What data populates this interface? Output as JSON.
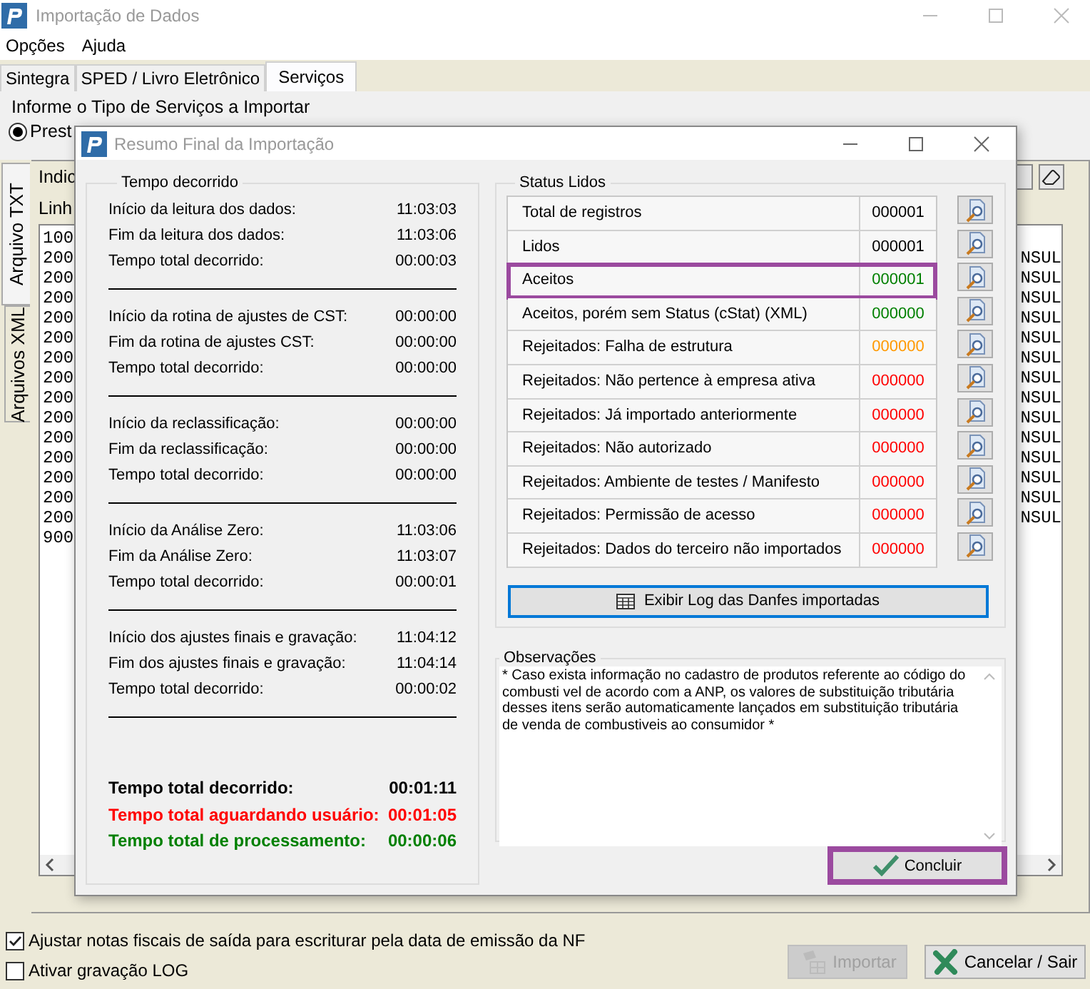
{
  "window": {
    "title": "Importação de Dados"
  },
  "menu": [
    "Opções",
    "Ajuda"
  ],
  "tabs": [
    {
      "label": "Sintegra",
      "selected": false
    },
    {
      "label": "SPED / Livro Eletrônico",
      "selected": false
    },
    {
      "label": "Serviços",
      "selected": true
    }
  ],
  "service_group": {
    "title": "Informe o Tipo de Serviços a Importar",
    "radio": {
      "label": "Prest",
      "selected": true
    }
  },
  "side_tabs": [
    {
      "label": "Arquivo TXT",
      "selected": true
    },
    {
      "label": "Arquivos XML",
      "selected": false
    }
  ],
  "labels": [
    "Indic",
    "Linh"
  ],
  "log_lines": [
    {
      "start": "100"
    },
    {
      "start": "200",
      "end": "NSUL"
    },
    {
      "start": "200",
      "end": "NSUL"
    },
    {
      "start": "200",
      "end": "NSUL"
    },
    {
      "start": "200",
      "end": "NSUL"
    },
    {
      "start": "200",
      "end": "NSUL"
    },
    {
      "start": "200",
      "end": "NSUL"
    },
    {
      "start": "200",
      "end": "NSUL"
    },
    {
      "start": "200",
      "end": "NSUL"
    },
    {
      "start": "200",
      "end": "NSUL"
    },
    {
      "start": "200",
      "end": "NSUL"
    },
    {
      "start": "200",
      "end": "NSUL"
    },
    {
      "start": "200",
      "end": "NSUL"
    },
    {
      "start": "200",
      "end": "NSUL"
    },
    {
      "start": "200",
      "end": "NSUL"
    },
    {
      "start": "900"
    }
  ],
  "options": [
    {
      "label": "Ajustar notas fiscais de saída para escriturar pela data de emissão da NF",
      "checked": true
    },
    {
      "label": "Ativar gravação LOG",
      "checked": false
    }
  ],
  "buttons": [
    {
      "kind": "import",
      "label": "Importar",
      "disabled": true
    },
    {
      "kind": "cancel",
      "label": "Cancelar / Sair",
      "disabled": false
    }
  ],
  "dialog": {
    "title": "Resumo Final da Importação",
    "time_group": {
      "title": "Tempo decorrido",
      "sections": [
        [
          {
            "label": "Início da leitura dos dados:",
            "value": "11:03:03"
          },
          {
            "label": "Fim da leitura dos dados:",
            "value": "11:03:06"
          },
          {
            "label": "Tempo total decorrido:",
            "value": "00:00:03"
          }
        ],
        [
          {
            "label": "Início da rotina de ajustes de CST:",
            "value": "00:00:00"
          },
          {
            "label": "Fim da rotina de ajustes CST:",
            "value": "00:00:00"
          },
          {
            "label": "Tempo total decorrido:",
            "value": "00:00:00"
          }
        ],
        [
          {
            "label": "Início da reclassificação:",
            "value": "00:00:00"
          },
          {
            "label": "Fim da reclassificação:",
            "value": "00:00:00"
          },
          {
            "label": "Tempo total decorrido:",
            "value": "00:00:00"
          }
        ],
        [
          {
            "label": "Início da Análise Zero:",
            "value": "11:03:06"
          },
          {
            "label": "Fim da Análise Zero:",
            "value": "11:03:07"
          },
          {
            "label": "Tempo total decorrido:",
            "value": "00:00:01"
          }
        ],
        [
          {
            "label": "Início dos ajustes finais e gravação:",
            "value": "11:04:12"
          },
          {
            "label": "Fim dos ajustes finais e gravação:",
            "value": "11:04:14"
          },
          {
            "label": "Tempo total decorrido:",
            "value": "00:00:02"
          }
        ]
      ],
      "totals": [
        {
          "label": "Tempo total decorrido:",
          "value": "00:01:11",
          "color": "#000000"
        },
        {
          "label": "Tempo total aguardando usuário:",
          "value": "00:01:05",
          "color": "#ff0000"
        },
        {
          "label": "Tempo total de processamento:",
          "value": "00:00:06",
          "color": "#008000"
        }
      ]
    },
    "status_group": {
      "title": "Status Lidos",
      "rows": [
        {
          "label": "Total de registros",
          "value": "000001",
          "color": "#000000",
          "highlighted": false
        },
        {
          "label": "Lidos",
          "value": "000001",
          "color": "#000000",
          "highlighted": false
        },
        {
          "label": "Aceitos",
          "value": "000001",
          "color": "#008000",
          "highlighted": true
        },
        {
          "label": "Aceitos, porém sem Status (cStat) (XML)",
          "value": "000000",
          "color": "#008000",
          "highlighted": false
        },
        {
          "label": "Rejeitados: Falha de estrutura",
          "value": "000000",
          "color": "#ff9900",
          "highlighted": false
        },
        {
          "label": "Rejeitados: Não pertence à empresa ativa",
          "value": "000000",
          "color": "#ff0000",
          "highlighted": false
        },
        {
          "label": "Rejeitados: Já importado anteriormente",
          "value": "000000",
          "color": "#ff0000",
          "highlighted": false
        },
        {
          "label": "Rejeitados: Não autorizado",
          "value": "000000",
          "color": "#ff0000",
          "highlighted": false
        },
        {
          "label": "Rejeitados: Ambiente de testes / Manifesto",
          "value": "000000",
          "color": "#ff0000",
          "highlighted": false
        },
        {
          "label": "Rejeitados: Permissão de acesso",
          "value": "000000",
          "color": "#ff0000",
          "highlighted": false
        },
        {
          "label": "Rejeitados: Dados do terceiro não importados",
          "value": "000000",
          "color": "#ff0000",
          "highlighted": false
        }
      ]
    },
    "log_button": "Exibir Log das Danfes importadas",
    "notes": {
      "title": "Observações",
      "text": "* Caso exista informação no cadastro de produtos referente ao código do combusti vel de acordo com a ANP, os valores de substituição tributária desses itens serão automaticamente lançados em substituição tributária de venda de combustiveis ao consumidor *"
    },
    "finish_button": {
      "label": "Concluir",
      "highlighted": true
    }
  }
}
